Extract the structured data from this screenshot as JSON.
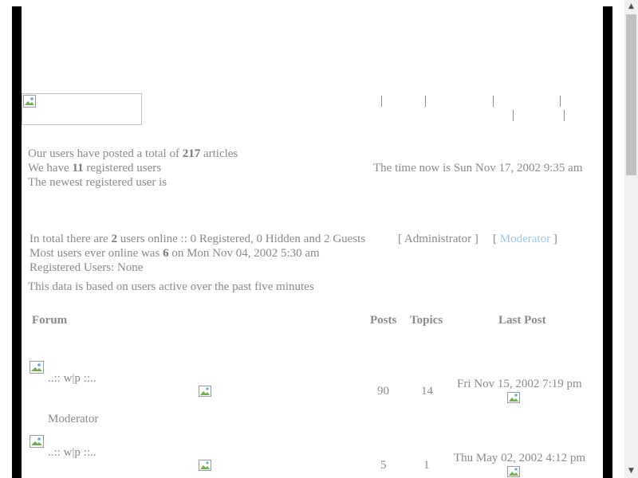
{
  "stats": {
    "posted_prefix": "Our users have posted a total of",
    "article_count": "217",
    "posted_suffix": "articles",
    "registered_prefix": "We have",
    "registered_count": "11",
    "registered_suffix": "registered users",
    "newest_user": "The newest registered user is",
    "current_time": "The time now is Sun Nov 17, 2002 9:35 am"
  },
  "online": {
    "total_prefix": "In total there are",
    "total_count": "2",
    "total_suffix": "users online :: 0 Registered, 0 Hidden and 2 Guests",
    "legend_admin": "[ Administrator ]",
    "legend_mod_open": "[",
    "legend_mod_label": "Moderator",
    "legend_mod_close": "]",
    "most_prefix": "Most users ever online was",
    "most_count": "6",
    "most_suffix": "on Mon Nov 04, 2002 5:30 am",
    "registered_users": "Registered Users: None",
    "note": "This data is based on users active over the past five minutes"
  },
  "forum_table": {
    "headers": {
      "forum": "Forum",
      "posts": "Posts",
      "topics": "Topics",
      "last_post": "Last Post"
    },
    "rows": [
      {
        "name": "..:: w|p ::..",
        "posts": "90",
        "topics": "14",
        "last_post": "Fri Nov 15, 2002 7:19 pm",
        "moderator_label": "Moderator"
      },
      {
        "name": "..:: w|p ::..",
        "posts": "5",
        "topics": "1",
        "last_post": "Thu May 02, 2002 4:12 pm"
      }
    ]
  },
  "icons": {
    "broken_image": "broken-image-icon",
    "scroll_up": "scroll-up-arrow-icon",
    "scroll_down": "scroll-down-arrow-icon"
  },
  "colors": {
    "text": "#8a8a8a",
    "border": "#000000",
    "moderator_link": "#99c9ee"
  }
}
